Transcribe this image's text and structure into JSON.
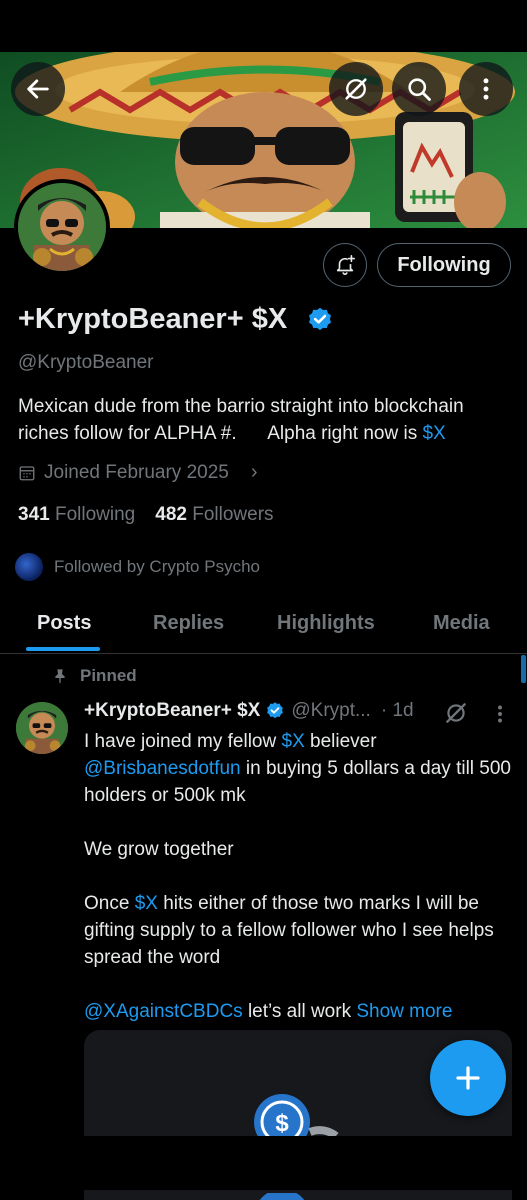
{
  "profile": {
    "display_name": "+KryptoBeaner+ $X",
    "handle": "@KryptoBeaner",
    "bio_line1": "Mexican dude from the barrio straight into blockchain",
    "bio_line2_prefix": "riches follow for ALPHA #.      Alpha right now is ",
    "bio_cashtag": "$X",
    "joined": "Joined February 2025",
    "following_count": "341",
    "following_label": "Following",
    "followers_count": "482",
    "followers_label": "Followers",
    "followed_by": "Followed by Crypto Psycho"
  },
  "actions": {
    "following_button": "Following",
    "back_icon": "arrow-left-icon",
    "grok_icon": "grok-icon",
    "search_icon": "search-icon",
    "more_icon": "more-vertical-icon",
    "bell_icon": "bell-plus-icon"
  },
  "tabs": [
    {
      "label": "Posts",
      "active": true
    },
    {
      "label": "Replies",
      "active": false
    },
    {
      "label": "Highlights",
      "active": false
    },
    {
      "label": "Media",
      "active": false
    }
  ],
  "post": {
    "pinned_label": "Pinned",
    "author_name": "+KryptoBeaner+ $X",
    "author_handle": "@Krypt...",
    "time": "· 1d",
    "line1_prefix": "I have joined my fellow ",
    "line1_cashtag": "$X",
    "line1_suffix": " believer",
    "mention1": "@Brisbanesdotfun",
    "line2_suffix": " in buying 5 dollars a day till 500 holders or 500k mk",
    "para2": "We grow together",
    "para3_prefix": "Once ",
    "para3_cashtag": "$X",
    "para3_suffix": " hits either of those two marks I will be gifting supply to a fellow follower who I see helps spread the word",
    "mention2": "@XAgainstCBDCs",
    "para4_suffix": " let’s all work ",
    "show_more": "Show more"
  },
  "colors": {
    "accent": "#1d9bf0",
    "background": "#000000",
    "text": "#e7e9ea",
    "muted": "#71767b"
  }
}
